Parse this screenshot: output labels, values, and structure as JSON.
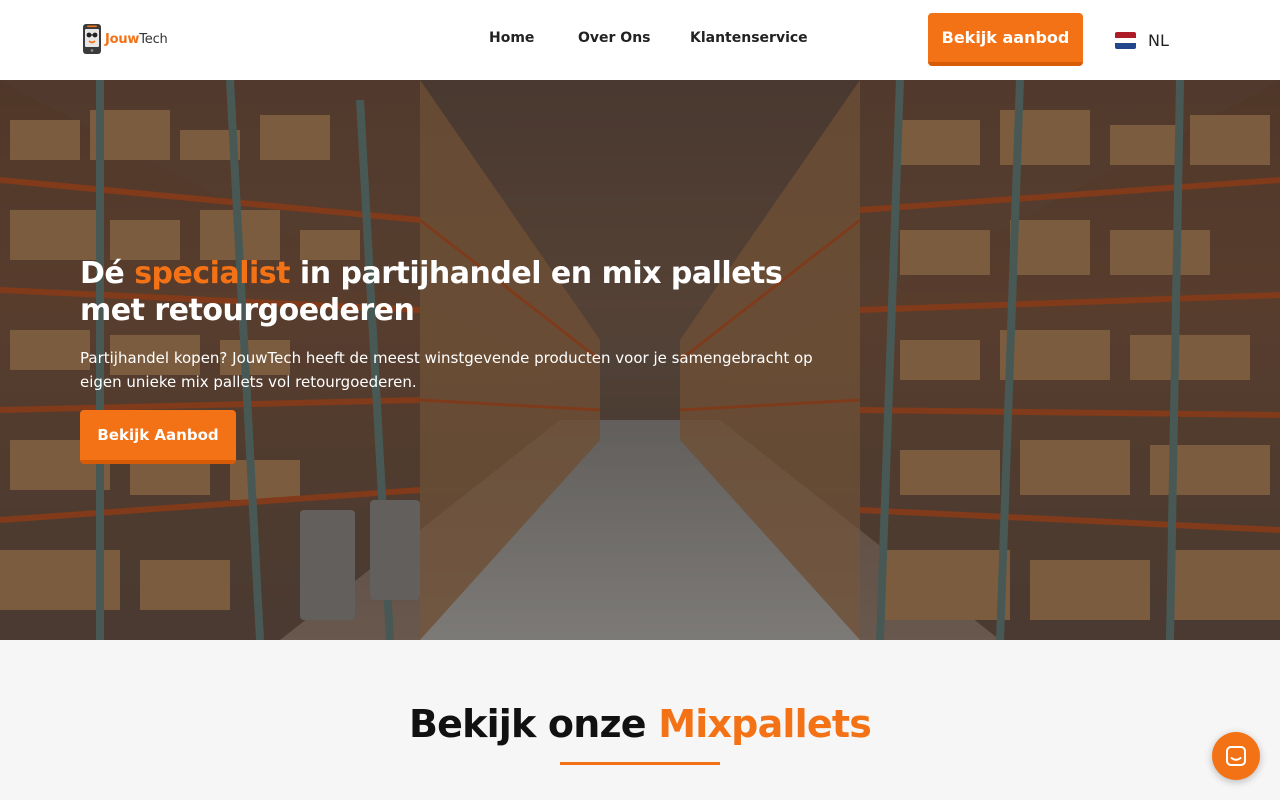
{
  "brand": {
    "name_part1": "Jouw",
    "name_part2": "Tech",
    "accent_color": "#f47216"
  },
  "nav": {
    "items": [
      {
        "label": "Home"
      },
      {
        "label": "Over Ons"
      },
      {
        "label": "Klantenservice"
      }
    ],
    "cta_label": "Bekijk aanbod",
    "language": "NL",
    "language_icon": "netherlands-flag-icon"
  },
  "hero": {
    "title_part1": "Dé ",
    "title_accent": "specialist",
    "title_part2": " in partijhandel en mix pallets met retourgoederen",
    "subtitle": "Partijhandel kopen? JouwTech heeft de meest winstgevende producten voor je samengebracht op eigen unieke mix pallets vol retourgoederen.",
    "cta_label": "Bekijk Aanbod"
  },
  "section": {
    "title_part1": "Bekijk onze ",
    "title_accent": "Mixpallets"
  },
  "chat": {
    "icon": "chat-icon"
  }
}
